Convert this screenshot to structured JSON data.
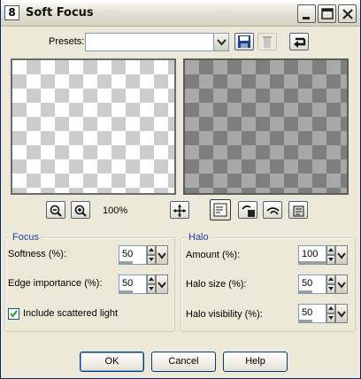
{
  "window": {
    "title": "Soft Focus",
    "app_icon_glyph": "8",
    "controls": [
      "minimize-icon",
      "maximize-icon",
      "close-icon"
    ]
  },
  "presets": {
    "label": "Presets:",
    "value": "",
    "icons": [
      "save-icon",
      "delete-icon",
      "reset-icon"
    ]
  },
  "preview": {
    "zoom": "100%",
    "zoom_icons": [
      "zoom-out-icon",
      "zoom-in-icon",
      "move-icon"
    ],
    "view_icons": [
      "proof-icon",
      "randomize-icon",
      "link-icon",
      "settings-icon"
    ]
  },
  "focus": {
    "title": "Focus",
    "softness_label": "Softness (%):",
    "softness_value": "50",
    "edge_label": "Edge importance (%):",
    "edge_value": "50",
    "scatter_label": "Include scattered light",
    "scatter_checked": true
  },
  "halo": {
    "title": "Halo",
    "amount_label": "Amount (%):",
    "amount_value": "100",
    "size_label": "Halo size (%):",
    "size_value": "50",
    "visibility_label": "Halo visibility (%):",
    "visibility_value": "50"
  },
  "buttons": {
    "ok": "OK",
    "cancel": "Cancel",
    "help": "Help"
  }
}
